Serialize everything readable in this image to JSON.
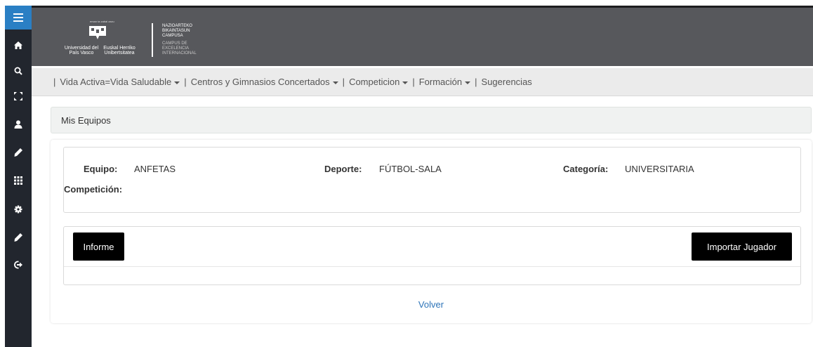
{
  "sidebar": {
    "items": [
      {
        "icon": "home-icon"
      },
      {
        "icon": "search-icon"
      },
      {
        "icon": "expand-icon"
      },
      {
        "icon": "user-icon"
      },
      {
        "icon": "pencil-icon"
      },
      {
        "icon": "grid-icon"
      },
      {
        "icon": "gear-icon"
      },
      {
        "icon": "pencil-icon"
      },
      {
        "icon": "logout-icon"
      }
    ]
  },
  "header": {
    "logo": {
      "tagline": "eman ta zabal zazu",
      "name_es": "Universidad del País Vasco",
      "name_eu": "Euskal Herriko Unibertsitatea",
      "campus_eu": "NAZIOARTEKO BIKAINTASUN CAMPUSA",
      "campus_es": "CAMPUS DE EXCELENCIA INTERNACIONAL"
    }
  },
  "nav": {
    "separator": "|",
    "items": [
      {
        "label": "Vida Activa=Vida Saludable",
        "dropdown": true
      },
      {
        "label": "Centros y Gimnasios Concertados",
        "dropdown": true
      },
      {
        "label": "Competicion",
        "dropdown": true
      },
      {
        "label": "Formación",
        "dropdown": true
      },
      {
        "label": "Sugerencias",
        "dropdown": false
      }
    ]
  },
  "section": {
    "title": "Mis Equipos"
  },
  "team": {
    "equipo_label": "Equipo:",
    "equipo_value": "ANFETAS",
    "deporte_label": "Deporte:",
    "deporte_value": "FÚTBOL-SALA",
    "categoria_label": "Categoría:",
    "categoria_value": "UNIVERSITARIA",
    "competicion_label": "Competición:",
    "competicion_value": ""
  },
  "actions": {
    "informe_label": "Informe",
    "importar_label": "Importar Jugador",
    "volver_label": "Volver"
  },
  "colors": {
    "sidebar_bg": "#22262e",
    "sidebar_accent": "#2a7fc4",
    "banner_bg": "#57585c",
    "nav_bg": "#ebebeb",
    "button_bg": "#000000",
    "link": "#2d74b8"
  }
}
